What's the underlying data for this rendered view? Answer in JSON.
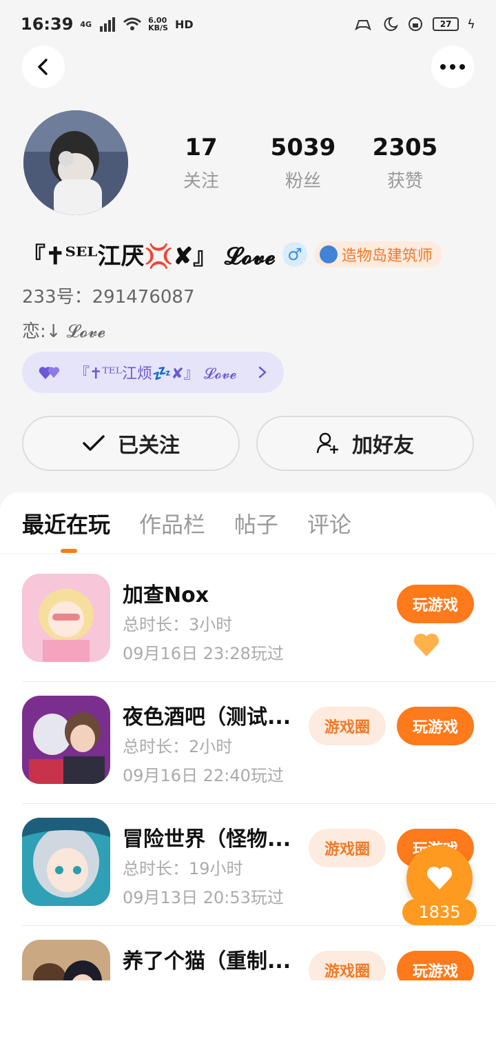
{
  "status_bar": {
    "time": "16:39",
    "network": "4G",
    "speed_value": "6.00",
    "speed_unit": "KB/S",
    "hd_label": "HD",
    "battery": "27"
  },
  "profile": {
    "following_count": "17",
    "following_label": "关注",
    "fans_count": "5039",
    "fans_label": "粉丝",
    "likes_count": "2305",
    "likes_label": "获赞",
    "nickname": "『✝ᵀᴱᴸ江厌💢✘』 𝓛𝓸𝓿𝓮",
    "gender_symbol": "♂",
    "role_badge": "造物岛建筑师",
    "uid": "233号：291476087",
    "bio": "恋:↓ 𝓛𝓸𝓿𝓮",
    "cp_name": "『✝ᵀᴱᴸ江烦💤✘』 𝓛𝓸𝓿𝓮"
  },
  "actions": {
    "followed_label": "已关注",
    "add_friend_label": "加好友"
  },
  "tabs": [
    {
      "label": "最近在玩"
    },
    {
      "label": "作品栏"
    },
    {
      "label": "帖子"
    },
    {
      "label": "评论"
    }
  ],
  "games": [
    {
      "title": "加查Nox",
      "duration": "总时长：3小时",
      "last_played": "09月16日 23:28玩过",
      "play_label": "玩游戏"
    },
    {
      "title": "夜色酒吧（测试...",
      "duration": "总时长：2小时",
      "last_played": "09月16日 22:40玩过",
      "circle_label": "游戏圈",
      "play_label": "玩游戏"
    },
    {
      "title": "冒险世界（怪物...",
      "duration": "总时长：19小时",
      "last_played": "09月13日 20:53玩过",
      "circle_label": "游戏圈",
      "play_label": "玩游戏"
    },
    {
      "title": "养了个猫（重制...",
      "duration": "",
      "last_played": "",
      "circle_label": "游戏圈",
      "play_label": "玩游戏"
    }
  ],
  "floating_like": {
    "count": "1835"
  },
  "colors": {
    "accent": "#ff7a1a",
    "accent_light": "#fdebe0",
    "purple": "#6d57d6"
  }
}
